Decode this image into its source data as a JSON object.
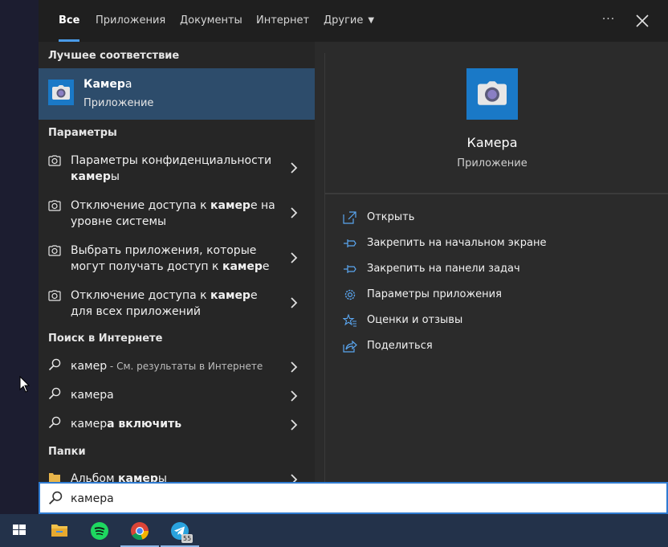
{
  "tabs": [
    {
      "label": "Все"
    },
    {
      "label": "Приложения"
    },
    {
      "label": "Документы"
    },
    {
      "label": "Интернет"
    },
    {
      "label": "Другие"
    }
  ],
  "icons": {
    "more": "more-options-icon",
    "close": "close-icon",
    "camera": "camera-icon",
    "search": "search-icon",
    "chevron": "chevron-right-icon",
    "folder": "folder-icon"
  },
  "best_match": {
    "header": "Лучшее соответствие",
    "title_bold": "Камер",
    "title_rest": "а",
    "subtitle": "Приложение"
  },
  "settings": {
    "header": "Параметры",
    "items": [
      {
        "pre": "Параметры конфиденциальности ",
        "bold": "камер",
        "post": "ы"
      },
      {
        "pre": "Отключение доступа к ",
        "bold": "камер",
        "post": "е на уровне системы"
      },
      {
        "pre": "Выбрать приложения, которые могут получать доступ к ",
        "bold": "камер",
        "post": "е"
      },
      {
        "pre": "Отключение доступа к ",
        "bold": "камер",
        "post": "е для всех приложений"
      }
    ]
  },
  "web": {
    "header": "Поиск в Интернете",
    "items": [
      {
        "bold": "камер",
        "rest": "",
        "hint": " - См. результаты в Интернете"
      },
      {
        "bold": "камер",
        "rest": "а",
        "hint": ""
      },
      {
        "bold": "камер",
        "rest": "а включить",
        "hint": ""
      }
    ]
  },
  "folders": {
    "header": "Папки",
    "items": [
      {
        "pre": "Альбом ",
        "bold": "камер",
        "post": "ы"
      }
    ]
  },
  "preview": {
    "title": "Камера",
    "subtitle": "Приложение",
    "actions": [
      {
        "label": "Открыть",
        "icon": "open-icon"
      },
      {
        "label": "Закрепить на начальном экране",
        "icon": "pin-icon"
      },
      {
        "label": "Закрепить на панели задач",
        "icon": "pin-icon"
      },
      {
        "label": "Параметры приложения",
        "icon": "gear-icon"
      },
      {
        "label": "Оценки и отзывы",
        "icon": "star-icon"
      },
      {
        "label": "Поделиться",
        "icon": "share-icon"
      }
    ]
  },
  "search": {
    "value": "камера",
    "placeholder": ""
  },
  "taskbar": {
    "items": [
      {
        "name": "start-button"
      },
      {
        "name": "file-explorer"
      },
      {
        "name": "spotify"
      },
      {
        "name": "chrome"
      },
      {
        "name": "telegram",
        "badge": "55"
      }
    ]
  },
  "colors": {
    "accent": "#1a79c7",
    "selection": "#2d4c6b",
    "panel": "#2b2b2b",
    "taskbar": "#23324a"
  }
}
